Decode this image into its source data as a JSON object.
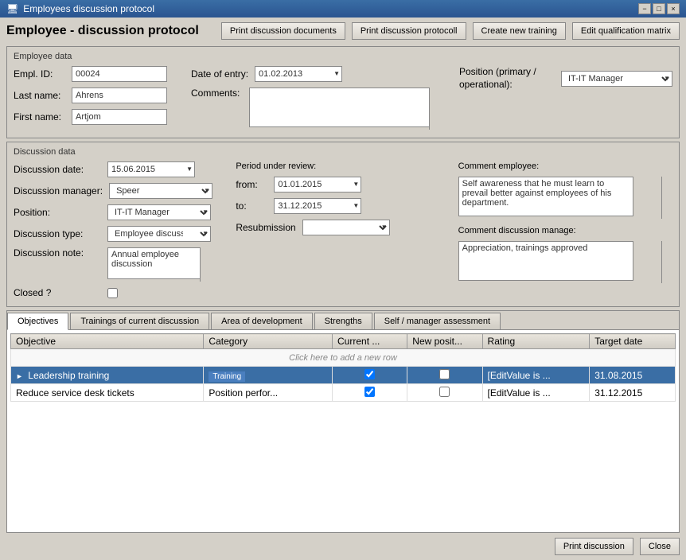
{
  "window": {
    "title": "Employees discussion protocol",
    "close_btn": "×",
    "minimize_btn": "−",
    "restore_btn": "□"
  },
  "header": {
    "title": "Employee - discussion protocol",
    "buttons": {
      "print_docs": "Print discussion documents",
      "print_protocol": "Print discussion protocoll",
      "create_training": "Create new training",
      "edit_matrix": "Edit qualification matrix"
    }
  },
  "employee_data": {
    "section_title": "Employee data",
    "empl_id_label": "Empl. ID:",
    "empl_id_value": "00024",
    "last_name_label": "Last name:",
    "last_name_value": "Ahrens",
    "first_name_label": "First name:",
    "first_name_value": "Artjom",
    "date_of_entry_label": "Date of entry:",
    "date_of_entry_value": "01.02.2013",
    "comments_label": "Comments:",
    "position_label": "Position (primary / operational):",
    "position_value": "IT-IT Manager"
  },
  "discussion_data": {
    "section_title": "Discussion data",
    "discussion_date_label": "Discussion date:",
    "discussion_date_value": "15.06.2015",
    "discussion_manager_label": "Discussion manager:",
    "discussion_manager_value": "Speer",
    "position_label": "Position:",
    "position_value": "IT-IT Manager",
    "discussion_type_label": "Discussion type:",
    "discussion_type_value": "Employee discussion",
    "discussion_note_label": "Discussion note:",
    "discussion_note_value": "Annual employee discussion",
    "closed_label": "Closed ?",
    "period_label": "Period under review:",
    "period_from_label": "from:",
    "period_from_value": "01.01.2015",
    "period_to_label": "to:",
    "period_to_value": "31.12.2015",
    "resubmission_label": "Resubmission",
    "resubmission_value": "",
    "comment_employee_label": "Comment employee:",
    "comment_employee_value": "Self awareness that he must learn to prevail better against employees of his department.",
    "comment_manager_label": "Comment discussion manage:",
    "comment_manager_value": "Appreciation, trainings approved"
  },
  "tabs": {
    "objectives_label": "Objectives",
    "trainings_label": "Trainings of current discussion",
    "area_label": "Area of development",
    "strengths_label": "Strengths",
    "self_assessment_label": "Self / manager assessment"
  },
  "objectives_table": {
    "columns": [
      "Objective",
      "Category",
      "Current ...",
      "New posit...",
      "Rating",
      "Target date"
    ],
    "add_row_text": "Click here to add a new row",
    "rows": [
      {
        "expander": ">",
        "objective": "Leadership training",
        "category": "Training",
        "current_checked": true,
        "new_pos_checked": false,
        "rating": "[EditValue is ...",
        "target_date": "31.08.2015",
        "selected": true
      },
      {
        "expander": "",
        "objective": "Reduce service desk tickets",
        "category": "Position perfor...",
        "current_checked": true,
        "new_pos_checked": false,
        "rating": "[EditValue is ...",
        "target_date": "31.12.2015",
        "selected": false
      }
    ]
  },
  "footer": {
    "print_discussion_label": "Print discussion",
    "close_label": "Close"
  }
}
